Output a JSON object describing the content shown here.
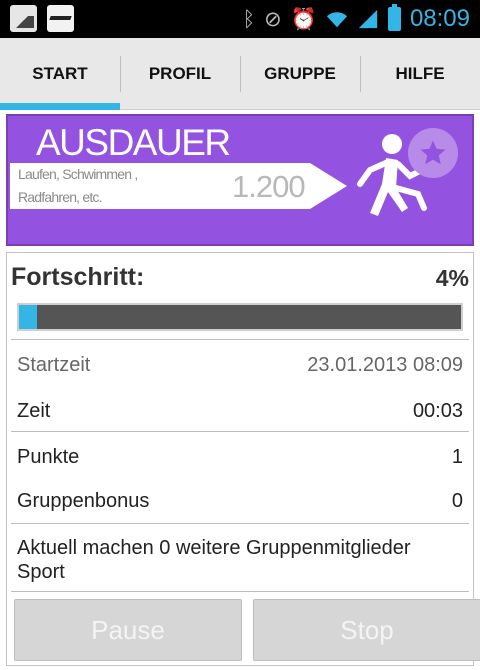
{
  "status_bar": {
    "time": "08:09",
    "icons": [
      "gallery-icon",
      "sport-app-icon",
      "bluetooth-icon",
      "mute-icon",
      "alarm-icon",
      "wifi-icon",
      "signal-icon",
      "battery-icon"
    ],
    "accent_color": "#33b5e5"
  },
  "tabs": [
    {
      "label": "START",
      "active": true
    },
    {
      "label": "PROFIL",
      "active": false
    },
    {
      "label": "GRUPPE",
      "active": false
    },
    {
      "label": "HILFE",
      "active": false
    }
  ],
  "banner": {
    "title": "AUSDAUER",
    "subtitle_line1": "Laufen, Schwimmen ,",
    "subtitle_line2": "Radfahren, etc.",
    "points": "1.200",
    "background_color": "#9353e0",
    "icons": [
      "runner-icon",
      "star-icon"
    ]
  },
  "progress": {
    "label": "Fortschritt:",
    "percent_text": "4%",
    "fraction": 0.04,
    "fill_color": "#33b5e5"
  },
  "details": [
    {
      "label": "Startzeit",
      "value": "23.01.2013 08:09"
    },
    {
      "label": "Zeit",
      "value": "00:03"
    },
    {
      "label": "Punkte",
      "value": "1"
    },
    {
      "label": "Gruppenbonus",
      "value": "0"
    }
  ],
  "info": {
    "text": "Aktuell machen 0 weitere Gruppenmitglieder Sport"
  },
  "buttons": {
    "pause_label": "Pause",
    "stop_label": "Stop"
  }
}
